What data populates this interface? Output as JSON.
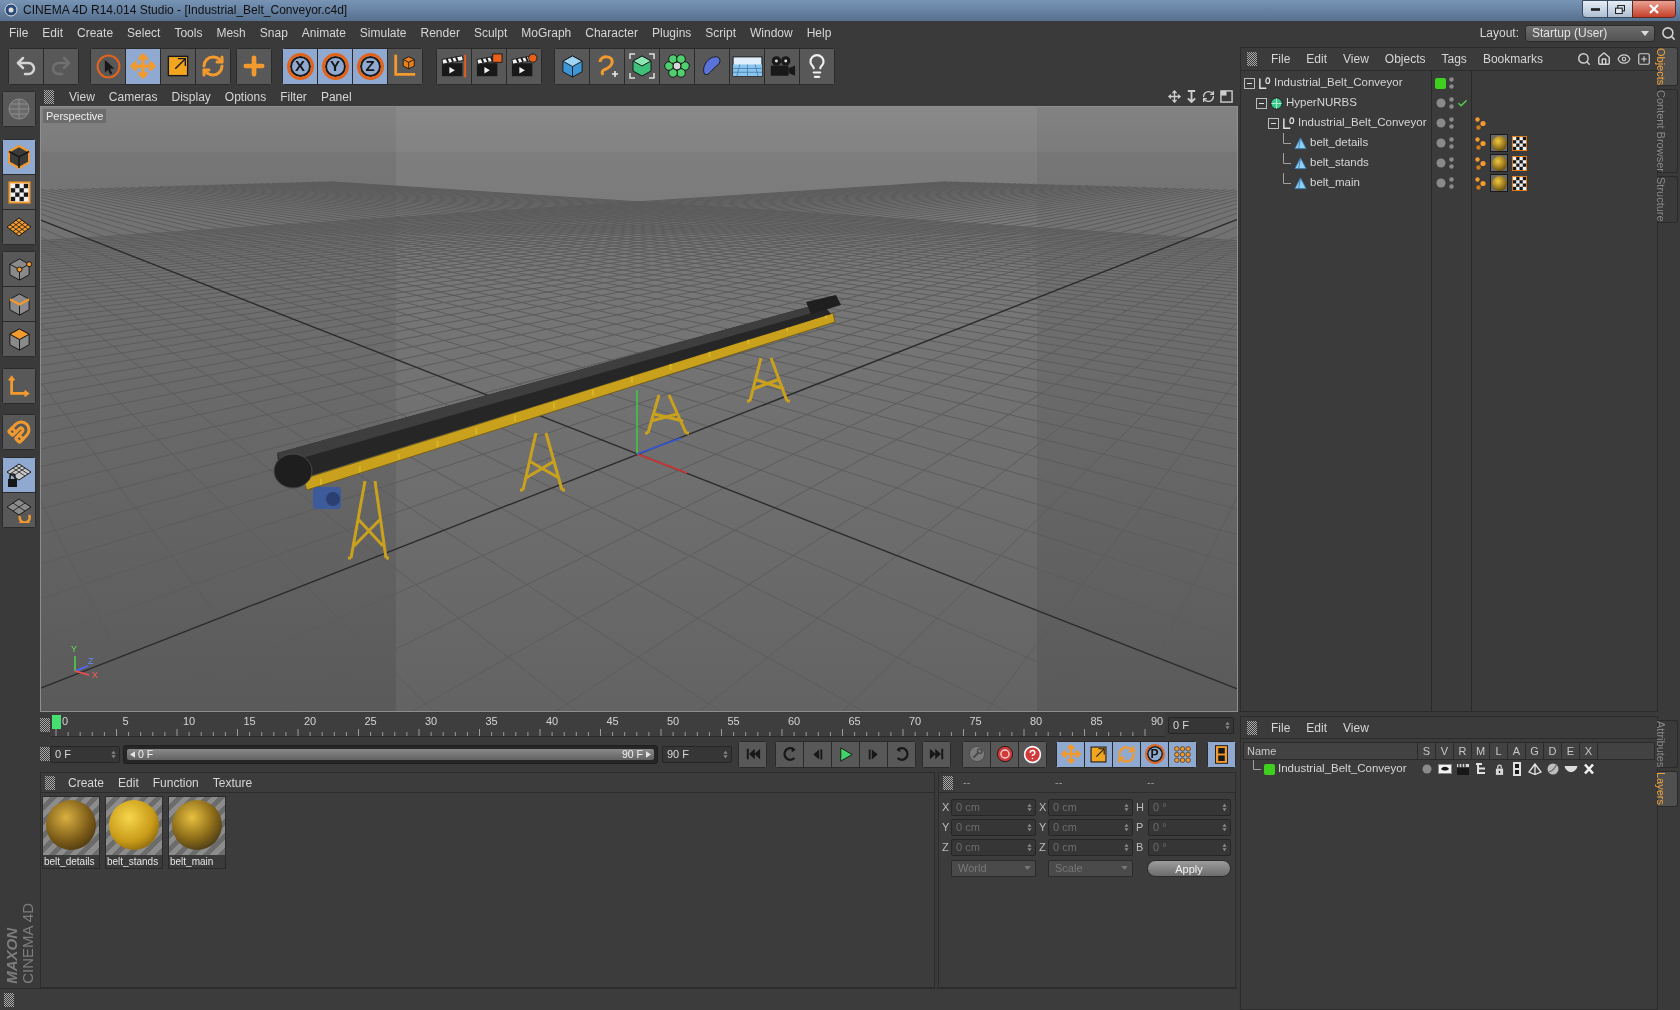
{
  "window": {
    "title": "CINEMA 4D R14.014 Studio - [Industrial_Belt_Conveyor.c4d]"
  },
  "menu_bar": {
    "items": [
      "File",
      "Edit",
      "Create",
      "Select",
      "Tools",
      "Mesh",
      "Snap",
      "Animate",
      "Simulate",
      "Render",
      "Sculpt",
      "MoGraph",
      "Character",
      "Plugins",
      "Script",
      "Window",
      "Help"
    ],
    "layout_label": "Layout:",
    "layout_value": "Startup (User)"
  },
  "toolbar": {
    "history": [
      {
        "disabled": false
      },
      {
        "disabled": true
      }
    ],
    "tools": [
      {
        "selected": false
      },
      {
        "selected": true
      },
      {
        "selected": false
      },
      {
        "selected": false
      }
    ],
    "axis_buttons": [
      {
        "label": "X",
        "on": true
      },
      {
        "label": "Y",
        "on": true
      },
      {
        "label": "Z",
        "on": true
      }
    ]
  },
  "left_toolbar": {
    "modes": [
      {
        "selected": true
      },
      {
        "selected": false
      },
      {
        "selected": false
      }
    ],
    "components": [
      {
        "selected": false
      },
      {
        "selected": false
      },
      {
        "selected": false
      }
    ],
    "workplane": [
      {
        "selected": true
      },
      {
        "selected": false
      }
    ]
  },
  "viewport": {
    "menu": [
      "View",
      "Cameras",
      "Display",
      "Options",
      "Filter",
      "Panel"
    ],
    "camera_label": "Perspective",
    "axis_labels": [
      "Y",
      "Z",
      "X"
    ]
  },
  "timeline": {
    "ticks": [
      "0",
      "5",
      "10",
      "15",
      "20",
      "25",
      "30",
      "35",
      "40",
      "45",
      "50",
      "55",
      "60",
      "65",
      "70",
      "75",
      "80",
      "85",
      "90"
    ],
    "playhead": {
      "level": 0
    },
    "current_frame": "0 F"
  },
  "playback": {
    "start_field": "0 F",
    "range": {
      "start": "0 F",
      "end": "90 F",
      "level": 1
    },
    "end_field": "90 F",
    "record_toggles": [
      {
        "on": true
      },
      {
        "on": true
      },
      {
        "on": true
      },
      {
        "label": "P",
        "on": true
      },
      {
        "on": true
      }
    ],
    "timeline_toggle": {
      "on": true
    }
  },
  "material_manager": {
    "menu": [
      "Create",
      "Edit",
      "Function",
      "Texture"
    ],
    "materials": [
      {
        "name": "belt_details"
      },
      {
        "name": "belt_stands"
      },
      {
        "name": "belt_main"
      }
    ]
  },
  "coordinates": {
    "headers": [
      "--",
      "--",
      "--"
    ],
    "disabled": true,
    "rows": [
      {
        "fields": [
          {
            "label": "X",
            "value": "0 cm"
          },
          {
            "label": "X",
            "value": "0 cm"
          },
          {
            "label": "H",
            "value": "0 °"
          }
        ]
      },
      {
        "fields": [
          {
            "label": "Y",
            "value": "0 cm"
          },
          {
            "label": "Y",
            "value": "0 cm"
          },
          {
            "label": "P",
            "value": "0 °"
          }
        ]
      },
      {
        "fields": [
          {
            "label": "Z",
            "value": "0 cm"
          },
          {
            "label": "Z",
            "value": "0 cm"
          },
          {
            "label": "B",
            "value": "0 °"
          }
        ]
      }
    ],
    "space": "World",
    "transform_mode": "Scale",
    "apply": "Apply"
  },
  "object_manager": {
    "menu": [
      "File",
      "Edit",
      "View",
      "Objects",
      "Tags",
      "Bookmarks"
    ],
    "objects": [
      {
        "name": "Industrial_Belt_Conveyor",
        "kind": "null",
        "expanded": true,
        "color": "#3fcf1f",
        "children": [
          {
            "name": "HyperNURBS",
            "kind": "nurbs",
            "expanded": true,
            "enabled": true,
            "children": [
              {
                "name": "Industrial_Belt_Conveyor",
                "kind": "null",
                "expanded": true,
                "tags": [
                  {
                    "kind": "phong"
                  }
                ],
                "children": [
                  {
                    "name": "belt_details",
                    "kind": "polygon",
                    "tags": [
                      {
                        "kind": "phong"
                      },
                      {
                        "kind": "material"
                      },
                      {
                        "kind": "texture"
                      }
                    ]
                  },
                  {
                    "name": "belt_stands",
                    "kind": "polygon",
                    "tags": [
                      {
                        "kind": "phong"
                      },
                      {
                        "kind": "material"
                      },
                      {
                        "kind": "texture"
                      }
                    ]
                  },
                  {
                    "name": "belt_main",
                    "kind": "polygon",
                    "tags": [
                      {
                        "kind": "phong"
                      },
                      {
                        "kind": "material"
                      },
                      {
                        "kind": "texture"
                      }
                    ]
                  }
                ]
              }
            ]
          }
        ]
      }
    ]
  },
  "layer_manager": {
    "menu": [
      "File",
      "Edit",
      "View"
    ],
    "columns": [
      "Name",
      "S",
      "V",
      "R",
      "M",
      "L",
      "A",
      "G",
      "D",
      "E",
      "X"
    ],
    "layers": [
      {
        "name": "Industrial_Belt_Conveyor",
        "color": "#3fcf1f"
      }
    ]
  },
  "side_tabs": {
    "top": [
      {
        "label": "Objects",
        "selected": true
      },
      {
        "label": "Content Browser",
        "selected": false
      },
      {
        "label": "Structure",
        "selected": false
      }
    ],
    "bottom": [
      {
        "label": "Attributes",
        "selected": false
      },
      {
        "label": "Layers",
        "selected": true
      }
    ]
  },
  "logo": {
    "brand": "MAXON",
    "product": "CINEMA 4D"
  }
}
